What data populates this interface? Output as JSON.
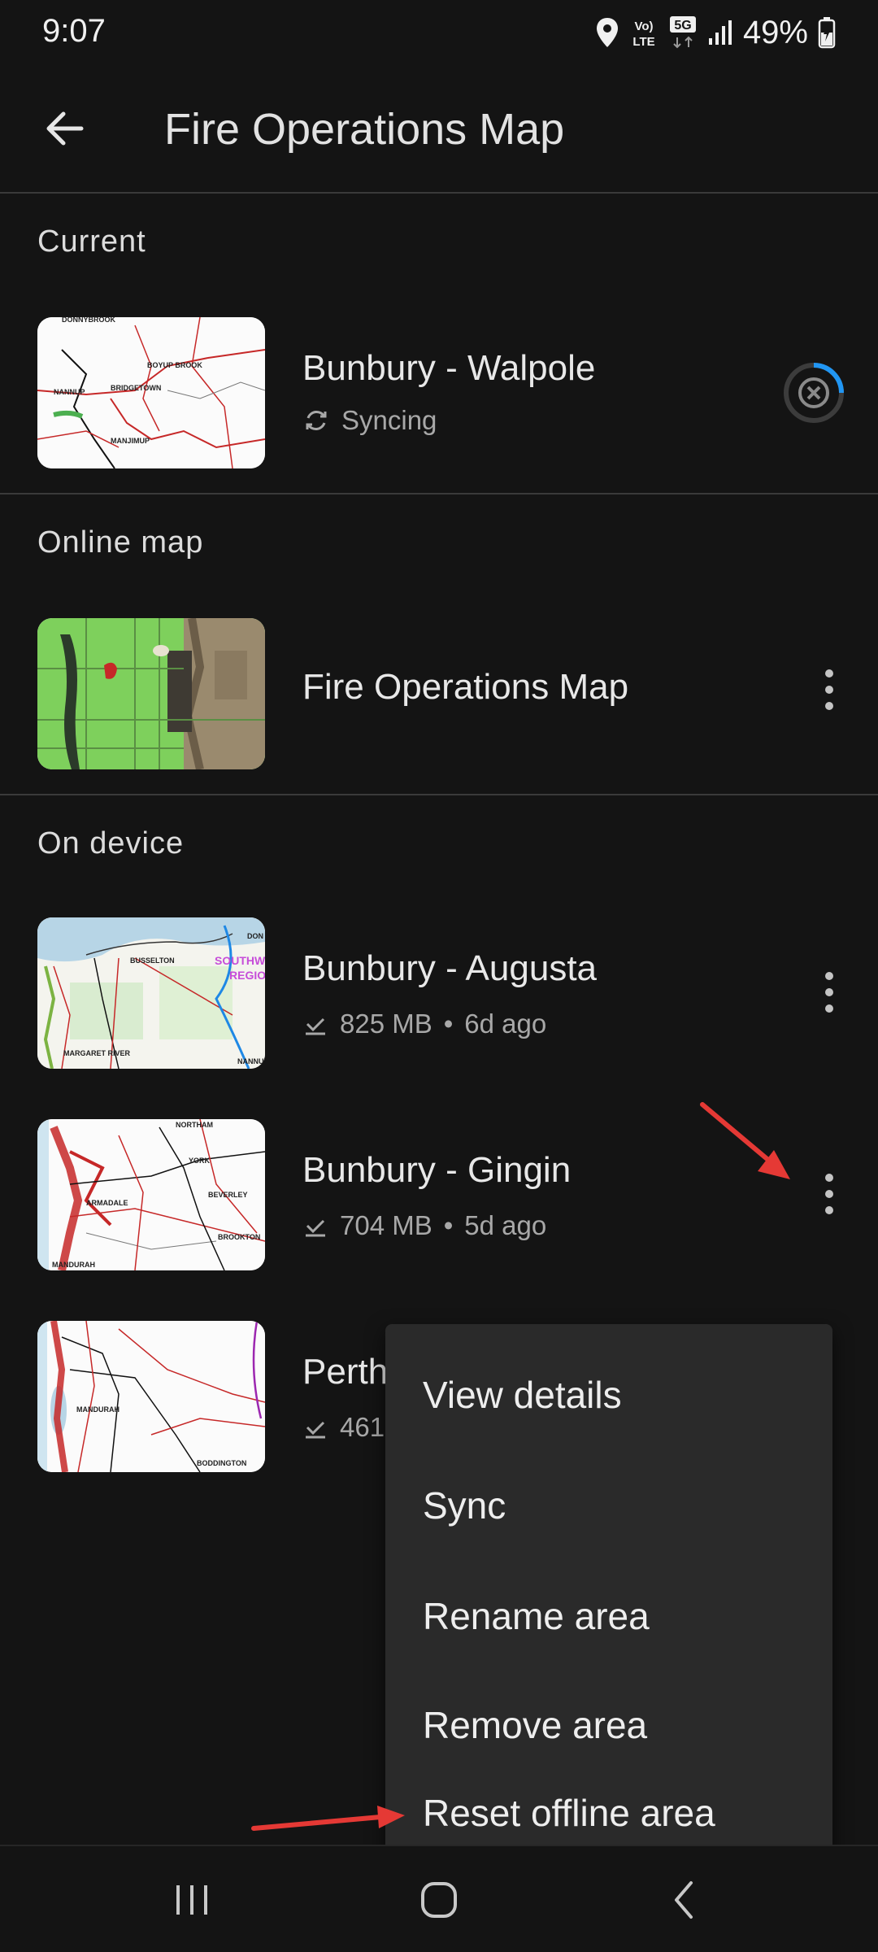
{
  "status_bar": {
    "time": "9:07",
    "battery": "49%",
    "icons": [
      "location-icon",
      "volte-icon",
      "5g-icon",
      "signal-icon",
      "battery-icon"
    ],
    "volte_label_top": "Vo)",
    "volte_label_bottom": "LTE",
    "network_label": "5G"
  },
  "app_bar": {
    "title": "Fire Operations Map",
    "back_icon": "arrow-back-icon"
  },
  "sections": {
    "current": {
      "header": "Current",
      "item": {
        "title": "Bunbury - Walpole",
        "status": "Syncing",
        "status_icon": "sync-icon",
        "action_icon": "cancel-sync-icon",
        "thumb_labels": [
          "DONNYBROOK",
          "BOYUP BROOK",
          "NANNUP",
          "BRIDGETOWN",
          "MANJIMUP"
        ]
      }
    },
    "online": {
      "header": "Online map",
      "item": {
        "title": "Fire Operations Map",
        "action_icon": "more-vert-icon"
      }
    },
    "on_device": {
      "header": "On device",
      "items": [
        {
          "title": "Bunbury - Augusta",
          "size": "825 MB",
          "separator": "•",
          "age": "6d ago",
          "thumb_labels": [
            "BUSSELTON",
            "SOUTHW",
            "REGIO",
            "MARGARET RIVER",
            "NANNU",
            "DON"
          ]
        },
        {
          "title": "Bunbury - Gingin",
          "size": "704 MB",
          "separator": "•",
          "age": "5d ago",
          "thumb_labels": [
            "NORTHAM",
            "YORK",
            "ARMADALE",
            "BEVERLEY",
            "BROOKTON",
            "MANDURAH"
          ]
        },
        {
          "title": "Perth",
          "size": "461",
          "thumb_labels": [
            "MANDURAH",
            "BODDINGTON"
          ]
        }
      ]
    }
  },
  "popup_menu": {
    "items": [
      "View details",
      "Sync",
      "Rename area",
      "Remove area",
      "Reset offline area"
    ]
  },
  "colors": {
    "background": "#141414",
    "menu_background": "#2a2a2a",
    "annotation_arrow": "#e53935",
    "sync_progress": "#2196f3"
  },
  "nav_bar": {
    "icons": [
      "recent-apps-icon",
      "home-icon",
      "back-icon"
    ]
  }
}
